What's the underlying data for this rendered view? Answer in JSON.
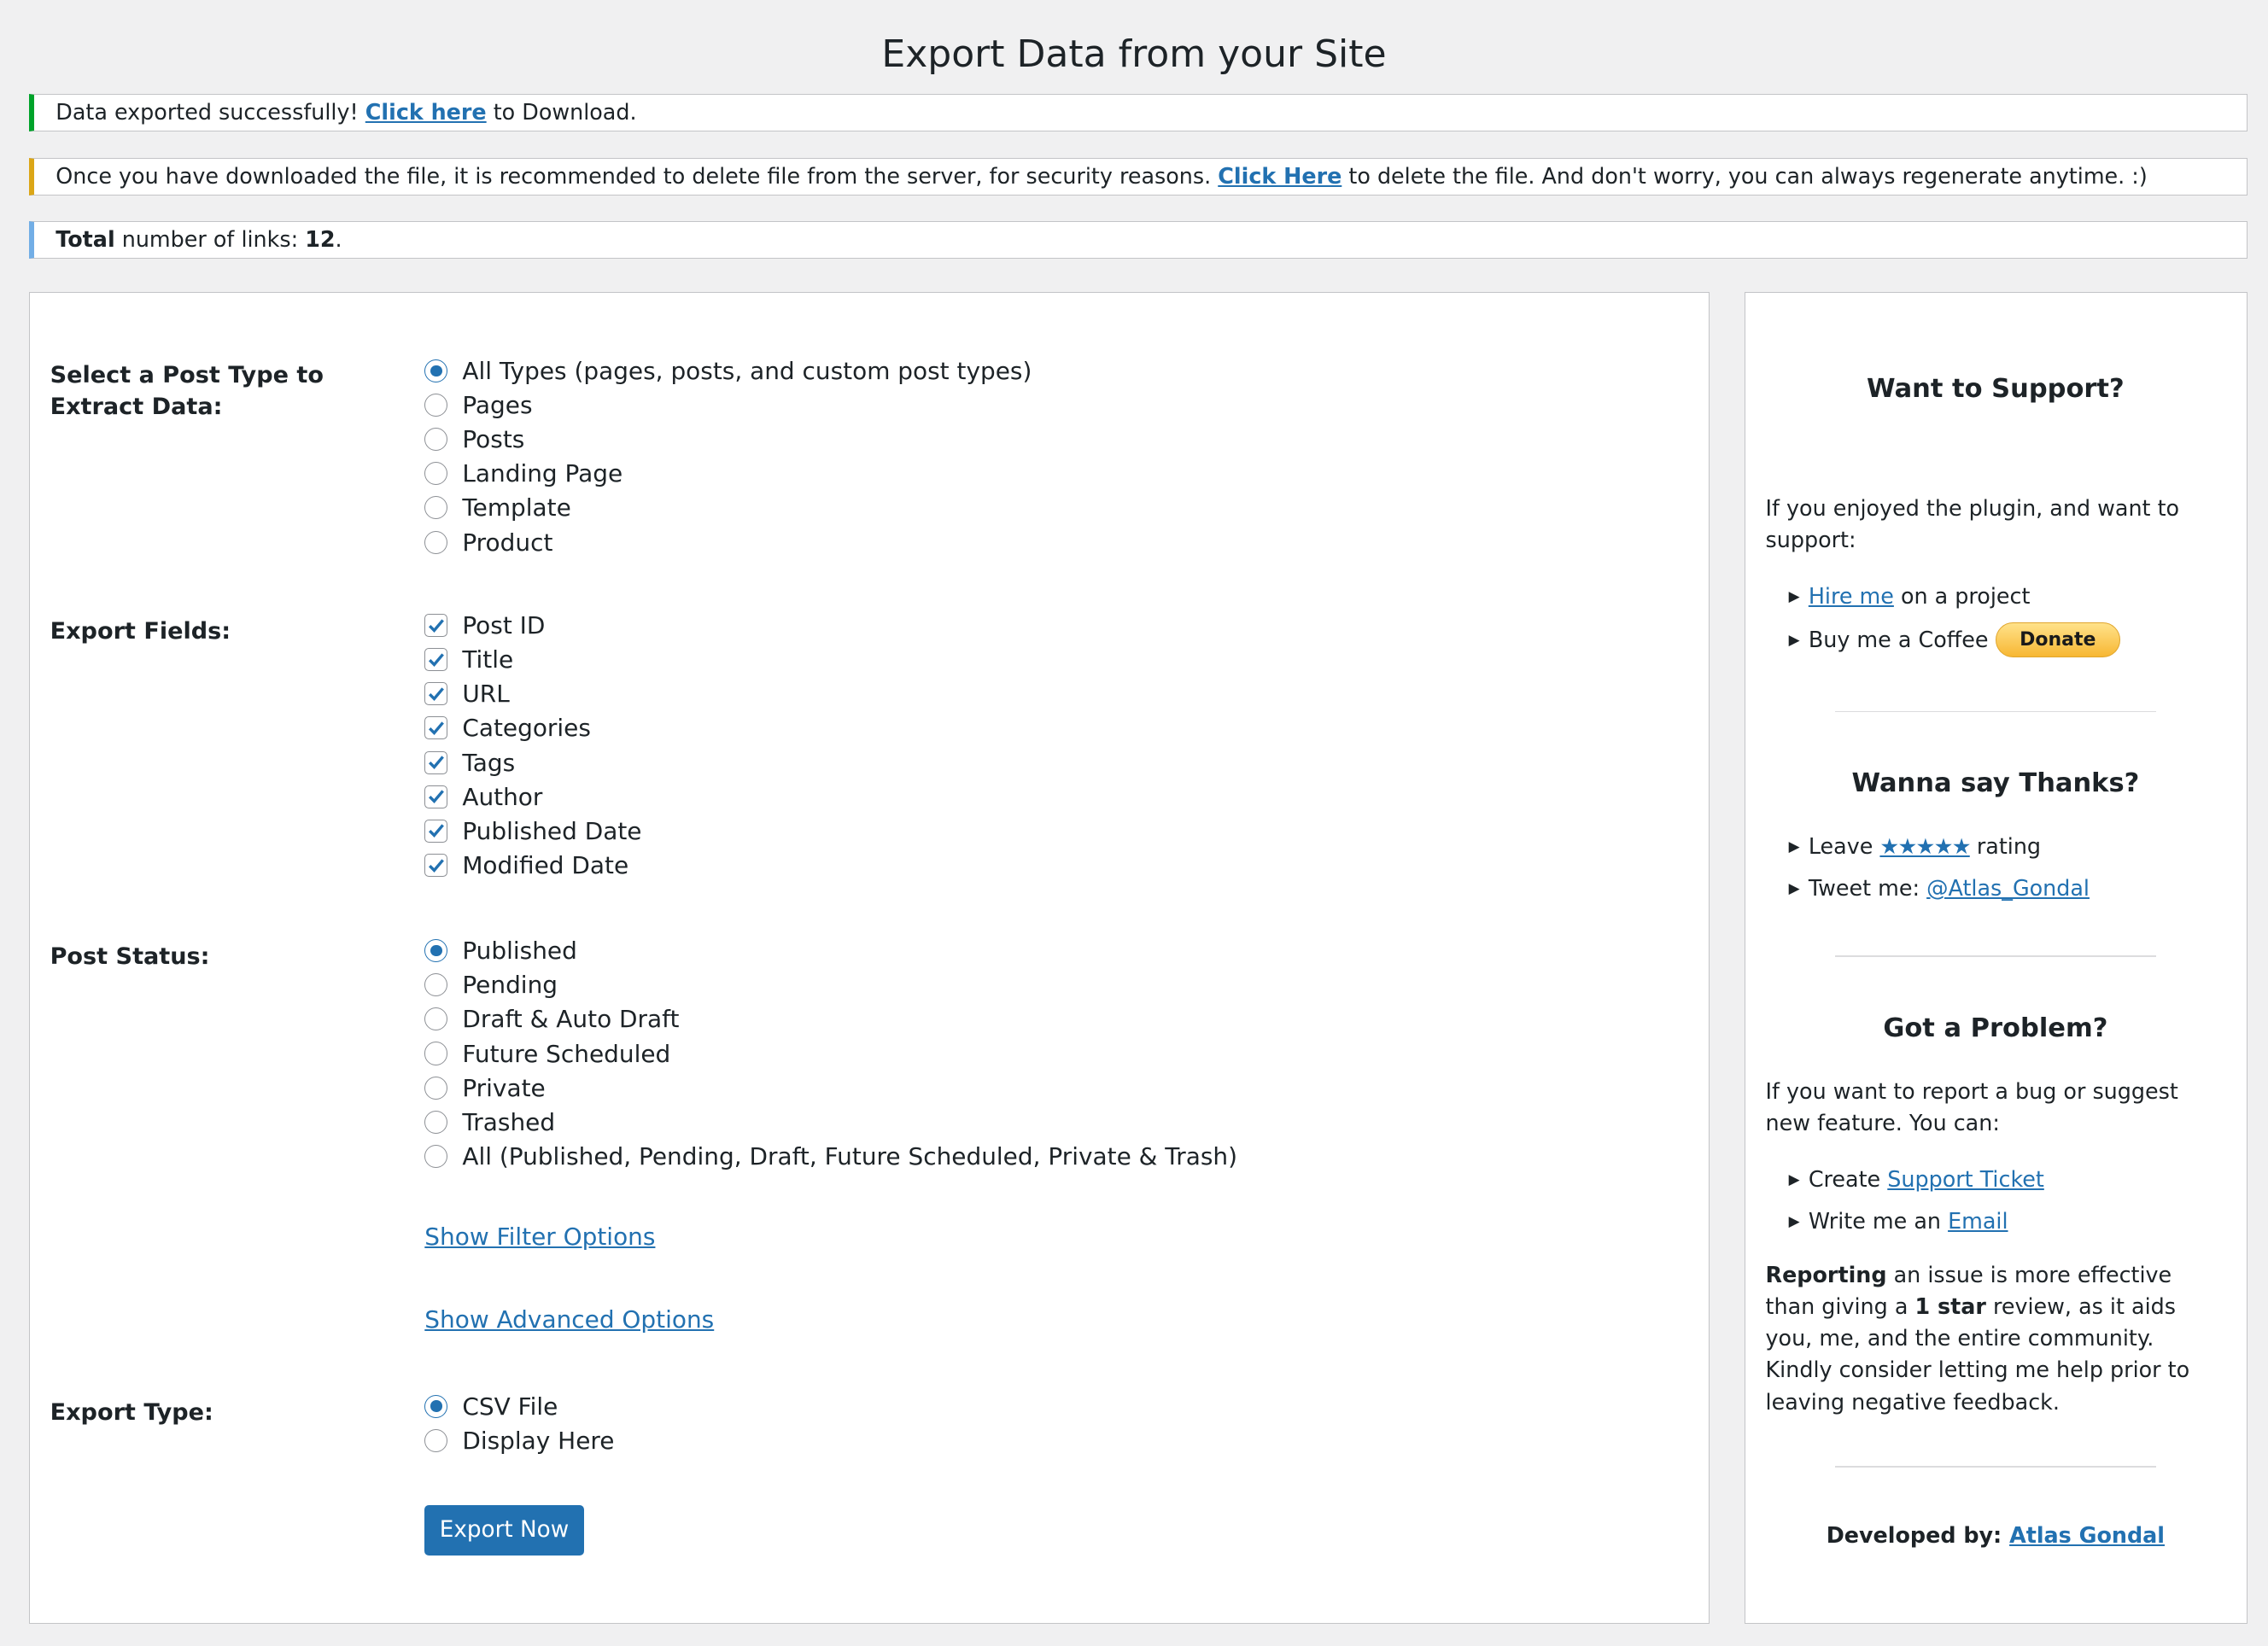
{
  "title": "Export Data from your Site",
  "notices": {
    "success": {
      "text_before": "Data exported successfully! ",
      "link": "Click here",
      "text_after": " to Download."
    },
    "warning": {
      "text_before": "Once you have downloaded the file, it is recommended to delete file from the server, for security reasons. ",
      "link": "Click Here",
      "text_after": " to delete the file. And don't worry, you can always regenerate anytime. :)"
    },
    "info": {
      "bold": "Total",
      "text": " number of links: ",
      "count": "12",
      "end": "."
    }
  },
  "colors": {
    "accent": "#2271b1",
    "success": "#00a32a",
    "warning": "#dba617",
    "info": "#72aee6"
  },
  "post_type": {
    "label": "Select a Post Type to Extract Data:",
    "options": [
      "All Types (pages, posts, and custom post types)",
      "Pages",
      "Posts",
      "Landing Page",
      "Template",
      "Product"
    ],
    "selected": "All Types (pages, posts, and custom post types)"
  },
  "export_fields": {
    "label": "Export Fields:",
    "options": [
      "Post ID",
      "Title",
      "URL",
      "Categories",
      "Tags",
      "Author",
      "Published Date",
      "Modified Date"
    ],
    "checked": [
      true,
      true,
      true,
      true,
      true,
      true,
      true,
      true
    ]
  },
  "post_status": {
    "label": "Post Status:",
    "options": [
      "Published",
      "Pending",
      "Draft & Auto Draft",
      "Future Scheduled",
      "Private",
      "Trashed",
      "All (Published, Pending, Draft, Future Scheduled, Private & Trash)"
    ],
    "selected": "Published"
  },
  "show_filter_options": "Show Filter Options",
  "show_advanced_options": "Show Advanced Options",
  "export_type": {
    "label": "Export Type:",
    "options": [
      "CSV File",
      "Display Here"
    ],
    "selected": "CSV File"
  },
  "export_button": "Export Now",
  "sidebar": {
    "support": {
      "heading": "Want to Support?",
      "text": "If you enjoyed the plugin, and want to support:",
      "hire_link": "Hire me",
      "hire_after": " on a project",
      "coffee": "Buy me a Coffee",
      "donate": "Donate"
    },
    "thanks": {
      "heading": "Wanna say Thanks?",
      "leave": "Leave ",
      "stars": "★★★★★",
      "rating": " rating",
      "tweet": "Tweet me: ",
      "tweet_link": "@Atlas_Gondal"
    },
    "problem": {
      "heading": "Got a Problem?",
      "text": "If you want to report a bug or suggest new feature. You can:",
      "create": "Create ",
      "ticket_link": "Support Ticket",
      "write": "Write me an ",
      "email_link": "Email",
      "reporting_bold": "Reporting",
      "reporting_text1": " an issue is more effective than giving a ",
      "one_star": "1 star",
      "reporting_text2": " review, as it aids you, me, and the entire community. Kindly consider letting me help prior to leaving negative feedback."
    },
    "developed_label": "Developed by: ",
    "developer_link": "Atlas Gondal"
  }
}
